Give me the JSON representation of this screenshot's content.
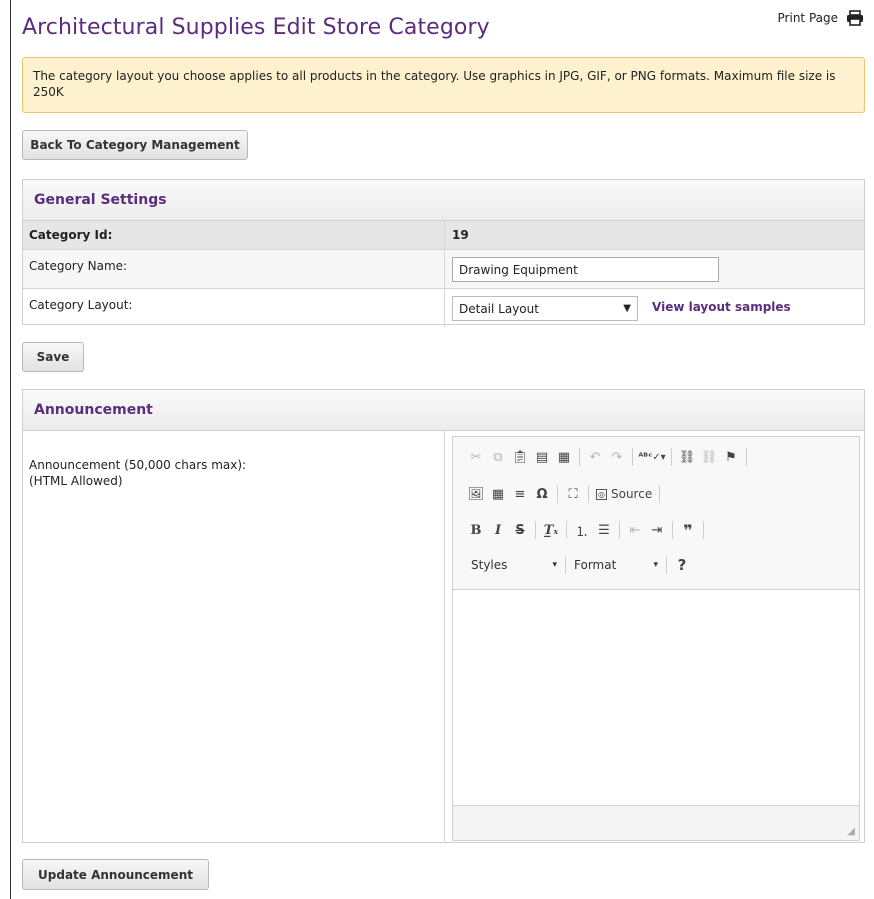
{
  "page": {
    "title": "Architectural Supplies Edit Store Category",
    "print_label": "Print Page",
    "notice": "The category layout you choose applies to all products in the category. Use graphics in JPG, GIF, or PNG formats. Maximum file size is 250K",
    "back_button": "Back To Category Management"
  },
  "general": {
    "heading": "General Settings",
    "id_label": "Category Id:",
    "id_value": "19",
    "name_label": "Category Name:",
    "name_value": "Drawing Equipment",
    "layout_label": "Category Layout:",
    "layout_value": "Detail Layout",
    "layout_link": "View layout samples",
    "save_button": "Save"
  },
  "announcement": {
    "heading": "Announcement",
    "label_line1": "Announcement (50,000 chars max):",
    "label_line2": "(HTML Allowed)",
    "source_label": "Source",
    "styles_label": "Styles",
    "format_label": "Format",
    "update_button": "Update Announcement"
  },
  "colors": {
    "accent": "#5a2d7e",
    "notice_bg": "#fdf1ce",
    "notice_border": "#f2c46a"
  },
  "icons": [
    "printer-icon",
    "cut-icon",
    "copy-icon",
    "paste-icon",
    "paste-text-icon",
    "paste-word-icon",
    "undo-icon",
    "redo-icon",
    "spellcheck-icon",
    "link-icon",
    "unlink-icon",
    "anchor-icon",
    "image-icon",
    "table-icon",
    "horizontal-line-icon",
    "special-char-icon",
    "maximize-icon",
    "source-icon",
    "bold-icon",
    "italic-icon",
    "strike-icon",
    "remove-format-icon",
    "numbered-list-icon",
    "bulleted-list-icon",
    "outdent-icon",
    "indent-icon",
    "blockquote-icon",
    "help-icon"
  ]
}
